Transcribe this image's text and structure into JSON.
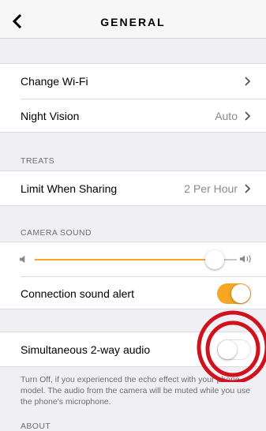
{
  "navbar": {
    "title": "GENERAL"
  },
  "rows": {
    "wifi": {
      "label": "Change Wi-Fi"
    },
    "night_vision": {
      "label": "Night Vision",
      "value": "Auto"
    },
    "limit_sharing": {
      "label": "Limit When Sharing",
      "value": "2 Per Hour"
    },
    "connection_alert": {
      "label": "Connection sound alert",
      "enabled": true
    },
    "two_way_audio": {
      "label": "Simultaneous 2-way audio",
      "enabled": false
    }
  },
  "sections": {
    "treats": "TREATS",
    "camera_sound": "CAMERA SOUND",
    "about": "ABOUT"
  },
  "volume": {
    "level": 0.93
  },
  "two_way_audio_note": "Turn Off, if you experienced the echo effect with your phone model. The audio from the camera will be muted while you use the phone's microphone.",
  "colors": {
    "accent": "#f5a623",
    "annotation": "#d0121e"
  },
  "icons": {
    "back": "chevron-left-icon",
    "disclosure": "chevron-right-icon",
    "speaker_low": "speaker-low-icon",
    "speaker_high": "speaker-high-icon"
  }
}
